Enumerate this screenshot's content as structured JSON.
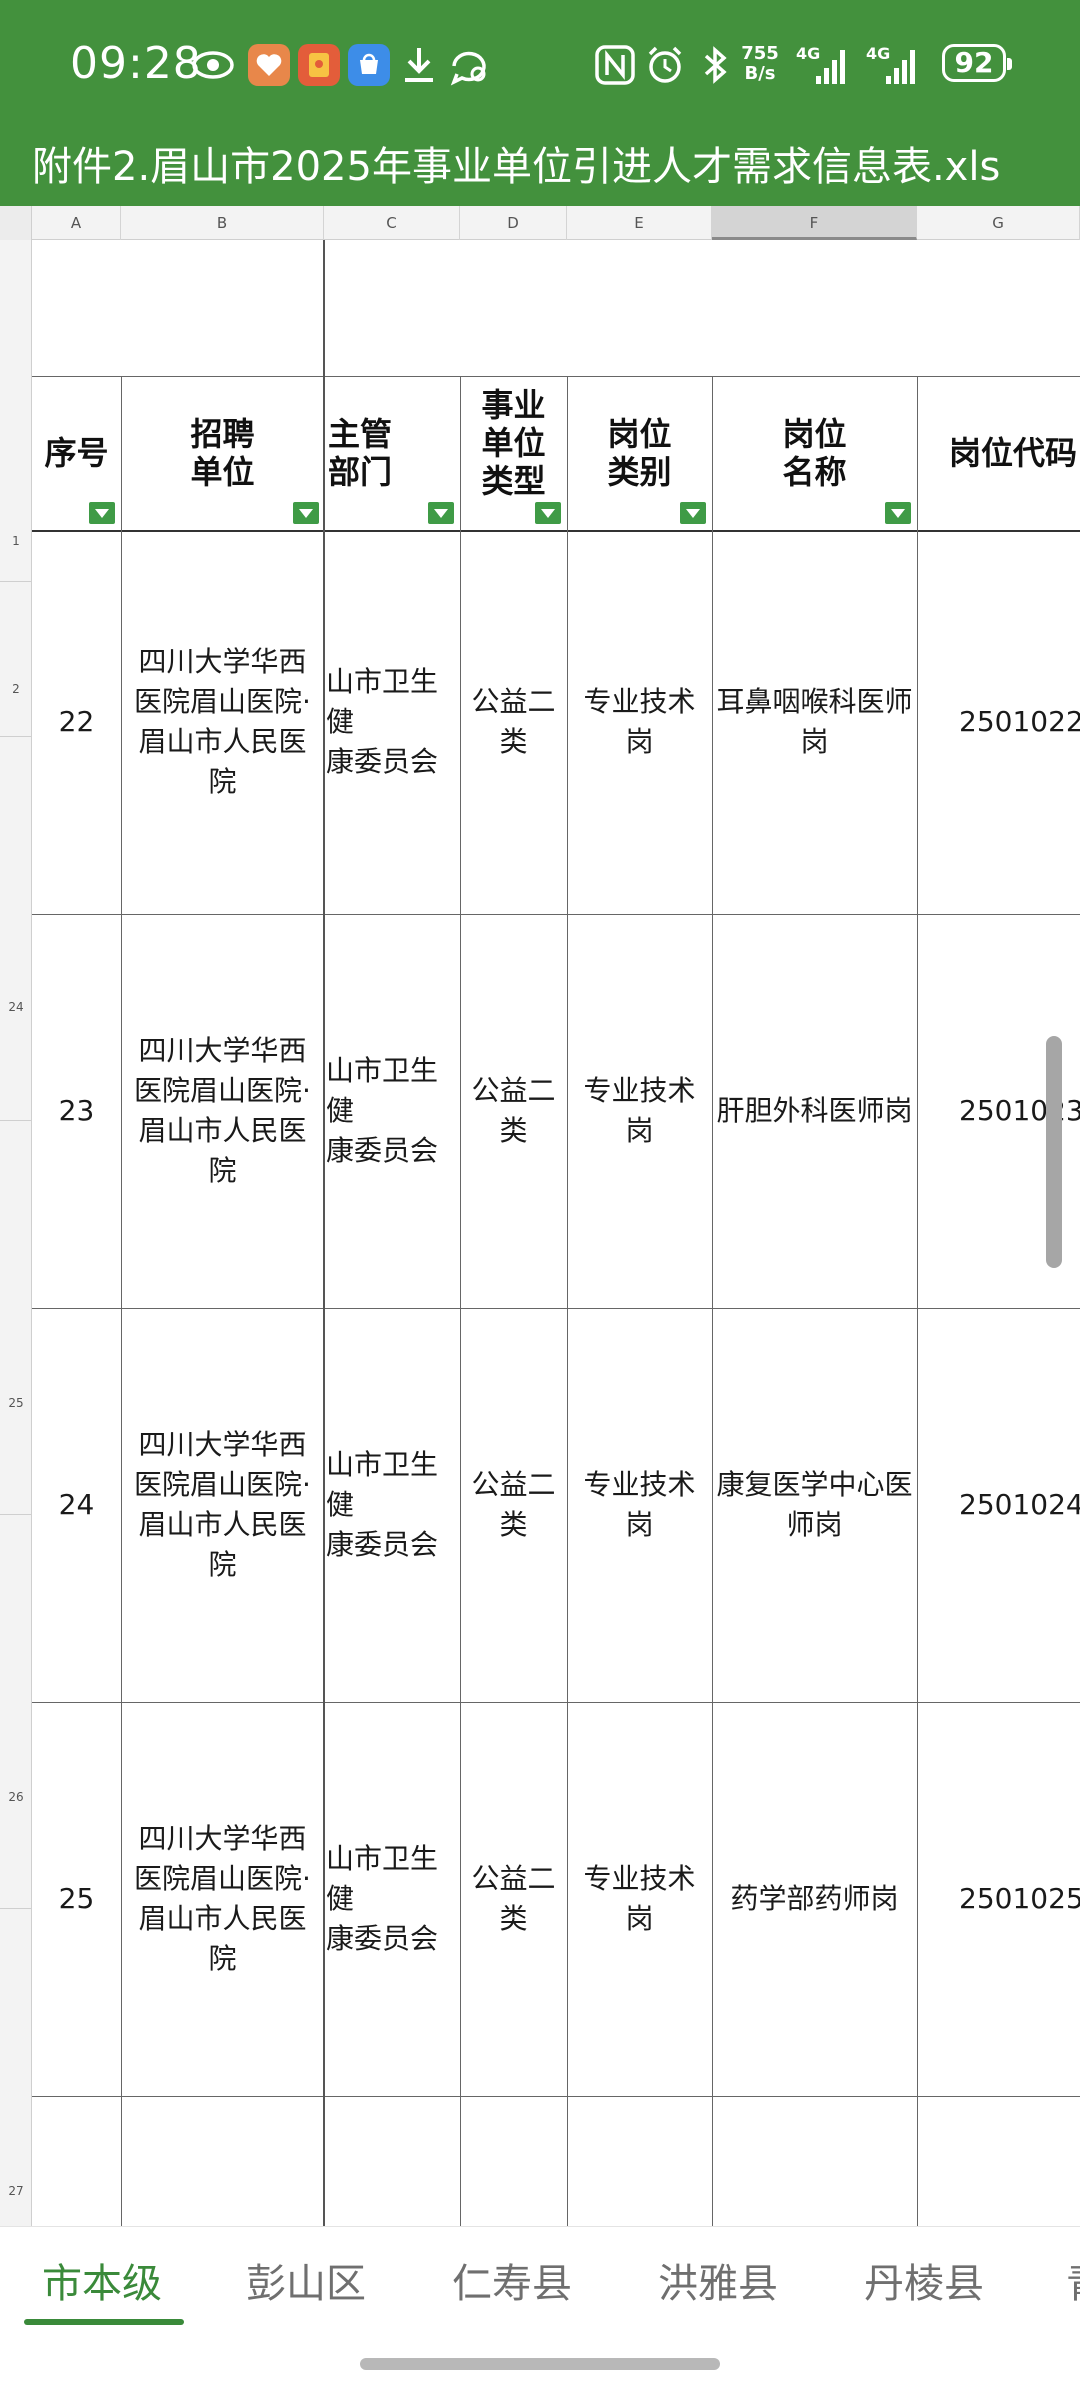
{
  "status_bar": {
    "time": "09:28",
    "net_speed_top": "755",
    "net_speed_bottom": "B/s",
    "sim1": "4G",
    "sim2": "4G",
    "battery": "92"
  },
  "file": {
    "title": "附件2.眉山市2025年事业单位引进人才需求信息表.xls"
  },
  "sheet": {
    "column_letters": [
      "A",
      "B",
      "C",
      "D",
      "E",
      "F",
      "G"
    ],
    "selected_column": "F",
    "row_numbers": [
      "1",
      "2",
      "24",
      "25",
      "26",
      "27"
    ],
    "headers": [
      "序号",
      "招聘\n单位",
      "主管\n部门",
      "事业\n单位\n类型",
      "岗位\n类别",
      "岗位\n名称",
      "岗位代码"
    ],
    "rows": [
      {
        "seq": "22",
        "unit": "四川大学华西医院眉山医院·眉山市人民医院",
        "dept": "眉山市卫生健康委员会",
        "dept_visible": "山市卫生健\n康委员会",
        "type": "公益二类",
        "category": "专业技术岗",
        "position": "耳鼻咽喉科医师岗",
        "code": "2501022"
      },
      {
        "seq": "23",
        "unit": "四川大学华西医院眉山医院·眉山市人民医院",
        "dept": "眉山市卫生健康委员会",
        "dept_visible": "山市卫生健\n康委员会",
        "type": "公益二类",
        "category": "专业技术岗",
        "position": "肝胆外科医师岗",
        "code": "2501023"
      },
      {
        "seq": "24",
        "unit": "四川大学华西医院眉山医院·眉山市人民医院",
        "dept": "眉山市卫生健康委员会",
        "dept_visible": "山市卫生健\n康委员会",
        "type": "公益二类",
        "category": "专业技术岗",
        "position": "康复医学中心医师岗",
        "code": "2501024"
      },
      {
        "seq": "25",
        "unit": "四川大学华西医院眉山医院·眉山市人民医院",
        "dept": "眉山市卫生健康委员会",
        "dept_visible": "山市卫生健\n康委员会",
        "type": "公益二类",
        "category": "专业技术岗",
        "position": "药学部药师岗",
        "code": "2501025"
      }
    ]
  },
  "tabs": [
    "市本级",
    "彭山区",
    "仁寿县",
    "洪雅县",
    "丹棱县",
    "青"
  ],
  "active_tab": 0,
  "colors": {
    "header_green": "#43913d",
    "tab_active": "#3a8a3a",
    "filter_green": "#3f9b46"
  }
}
